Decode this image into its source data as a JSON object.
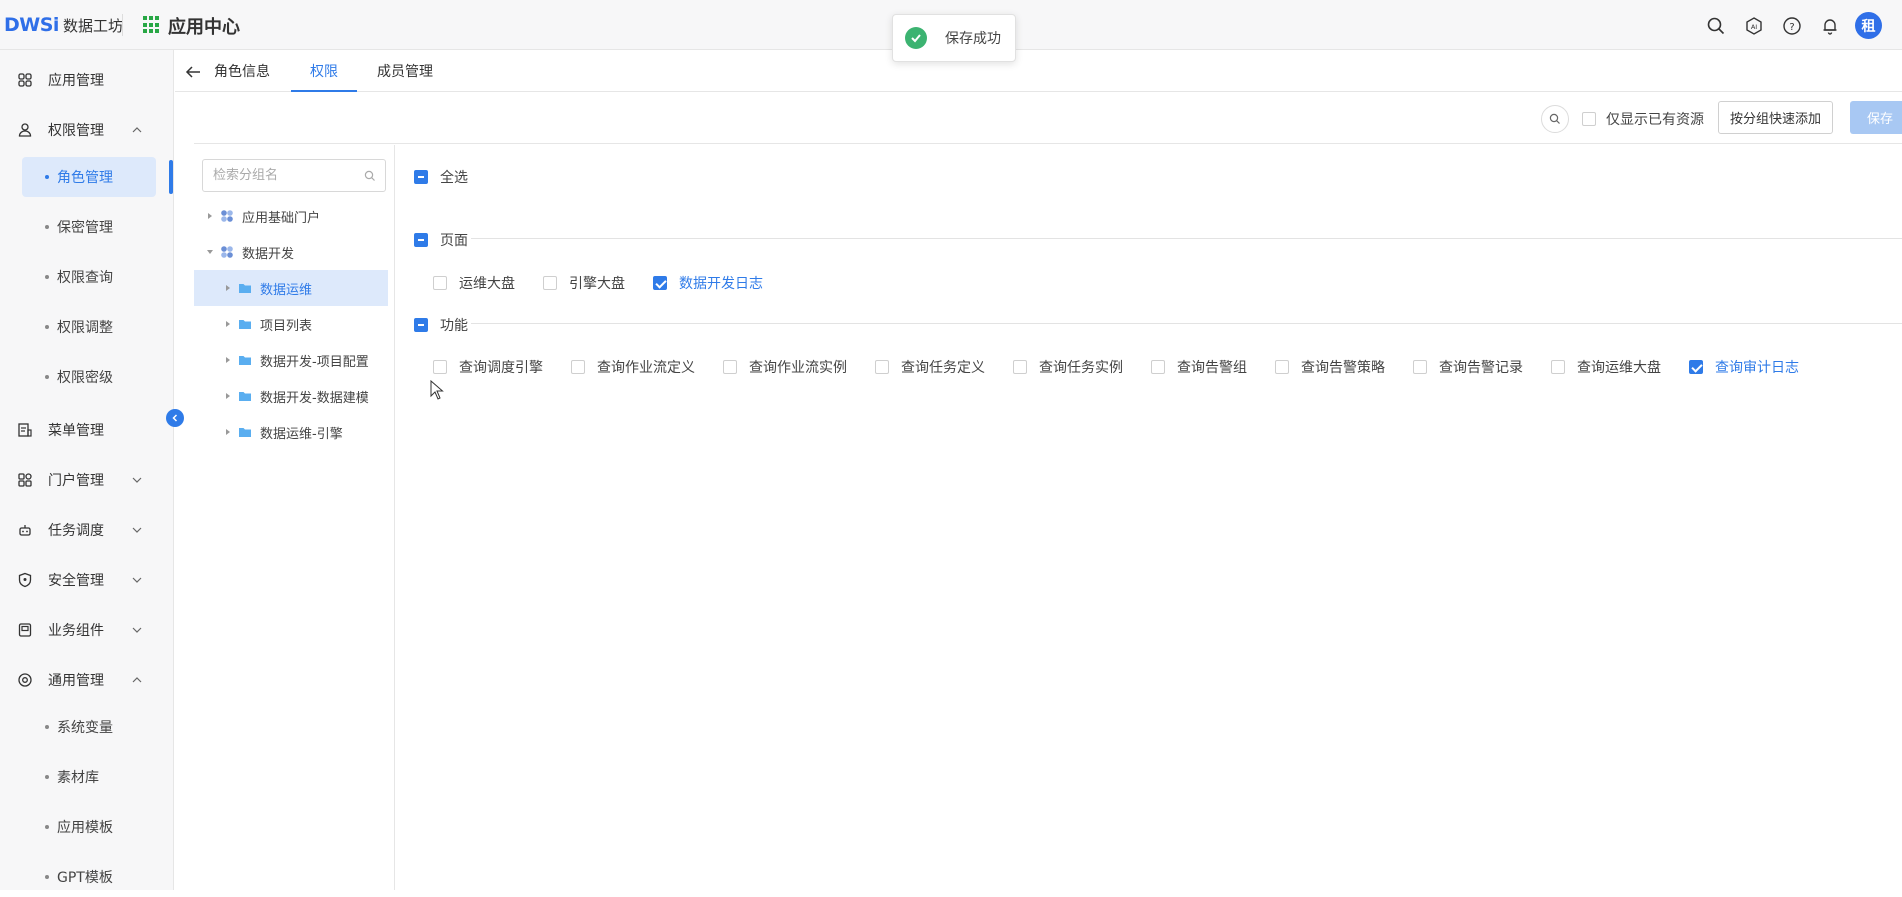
{
  "header": {
    "logo_mark": "DWSi",
    "logo_text": "数据工坊",
    "app_title": "应用中心",
    "avatar_text": "租",
    "icons": [
      "search-icon",
      "ai-icon",
      "help-icon",
      "bell-icon"
    ]
  },
  "toast": {
    "message": "保存成功",
    "icon": "success-check-icon",
    "color": "#3cb371"
  },
  "sidebar": {
    "items": [
      {
        "label": "应用管理",
        "icon": "grid-icon"
      },
      {
        "label": "权限管理",
        "icon": "user-lock-icon",
        "expanded": true
      },
      {
        "label": "菜单管理",
        "icon": "menu-doc-icon"
      },
      {
        "label": "门户管理",
        "icon": "portal-icon",
        "expanded": false
      },
      {
        "label": "任务调度",
        "icon": "robot-icon",
        "expanded": false
      },
      {
        "label": "安全管理",
        "icon": "shield-icon",
        "expanded": false
      },
      {
        "label": "业务组件",
        "icon": "component-icon",
        "expanded": false
      },
      {
        "label": "通用管理",
        "icon": "settings-icon",
        "expanded": true
      }
    ],
    "perm_sub": [
      "角色管理",
      "保密管理",
      "权限查询",
      "权限调整",
      "权限密级"
    ],
    "general_sub": [
      "系统变量",
      "素材库",
      "应用模板",
      "GPT模板"
    ],
    "active_sub": "角色管理"
  },
  "tabs": {
    "items": [
      "角色信息",
      "权限",
      "成员管理"
    ],
    "active": "权限"
  },
  "toolbar": {
    "show_only_label": "仅显示已有资源",
    "show_only_checked": false,
    "group_add_label": "按分组快速添加",
    "save_label": "保存"
  },
  "group_tree": {
    "search_placeholder": "检索分组名",
    "nodes": [
      {
        "label": "应用基础门户",
        "level": 0,
        "type": "app",
        "expanded": false
      },
      {
        "label": "数据开发",
        "level": 0,
        "type": "app",
        "expanded": true
      },
      {
        "label": "数据运维",
        "level": 1,
        "type": "folder",
        "selected": true
      },
      {
        "label": "项目列表",
        "level": 1,
        "type": "folder"
      },
      {
        "label": "数据开发-项目配置",
        "level": 1,
        "type": "folder"
      },
      {
        "label": "数据开发-数据建模",
        "level": 1,
        "type": "folder"
      },
      {
        "label": "数据运维-引擎",
        "level": 1,
        "type": "folder"
      }
    ]
  },
  "permissions": {
    "select_all_label": "全选",
    "sections": [
      {
        "title": "页面",
        "options": [
          {
            "label": "运维大盘",
            "checked": false
          },
          {
            "label": "引擎大盘",
            "checked": false
          },
          {
            "label": "数据开发日志",
            "checked": true
          }
        ]
      },
      {
        "title": "功能",
        "options": [
          {
            "label": "查询调度引擎",
            "checked": false
          },
          {
            "label": "查询作业流定义",
            "checked": false
          },
          {
            "label": "查询作业流实例",
            "checked": false
          },
          {
            "label": "查询任务定义",
            "checked": false
          },
          {
            "label": "查询任务实例",
            "checked": false
          },
          {
            "label": "查询告警组",
            "checked": false
          },
          {
            "label": "查询告警策略",
            "checked": false
          },
          {
            "label": "查询告警记录",
            "checked": false
          },
          {
            "label": "查询运维大盘",
            "checked": false
          },
          {
            "label": "查询审计日志",
            "checked": true
          }
        ]
      }
    ]
  },
  "colors": {
    "primary": "#2f7be8",
    "success": "#3cb371",
    "selected_bg": "#dde9fb",
    "save_disabled": "#a8c8f3"
  }
}
